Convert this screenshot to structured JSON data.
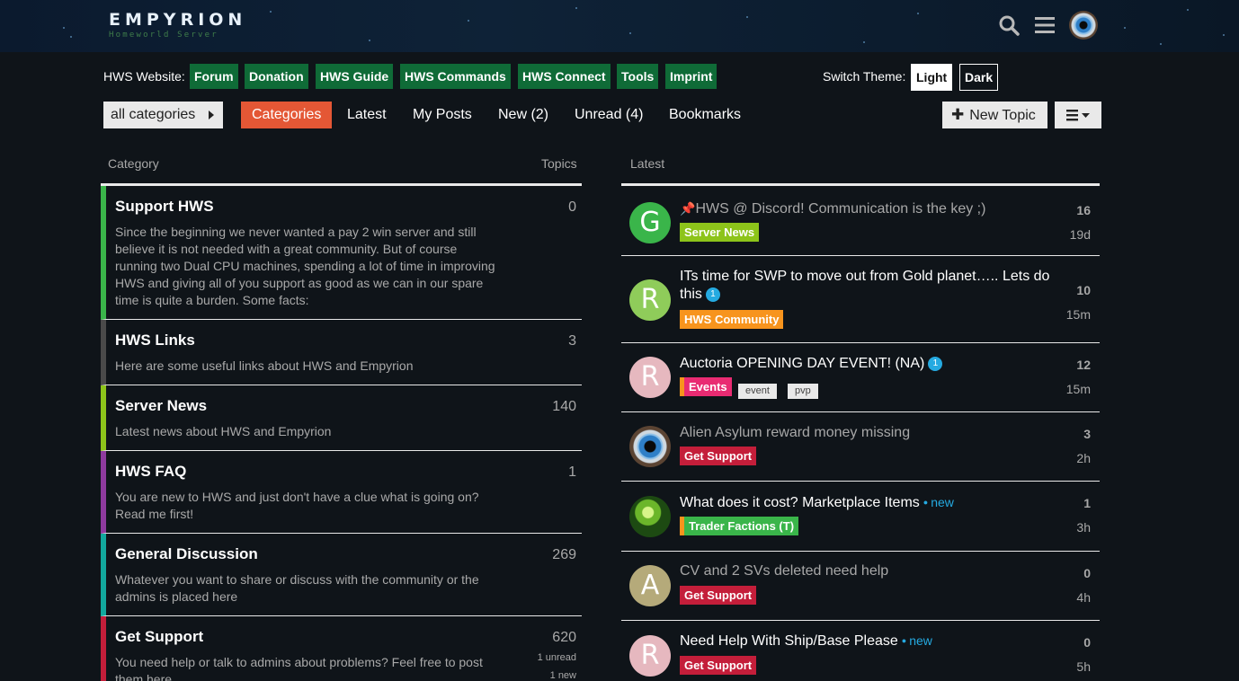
{
  "header": {
    "logo_name": "EMPYRION",
    "logo_sub": "Homeworld Server",
    "search_icon": "search-icon",
    "menu_icon": "hamburger-icon",
    "avatar_icon": "eye-avatar"
  },
  "links": {
    "label": "HWS Website:",
    "items": [
      "Forum",
      "Donation",
      "HWS Guide",
      "HWS Commands",
      "HWS Connect",
      "Tools",
      "Imprint"
    ],
    "accent": "#0f6b37"
  },
  "theme": {
    "label": "Switch Theme:",
    "light": "Light",
    "dark": "Dark"
  },
  "nav": {
    "category_dropdown": "all categories",
    "items": [
      "Categories",
      "Latest",
      "My Posts",
      "New (2)",
      "Unread (4)",
      "Bookmarks"
    ],
    "active_color": "#e45735",
    "new_topic": "New Topic"
  },
  "columns": {
    "category": "Category",
    "topics": "Topics",
    "latest": "Latest"
  },
  "categories": [
    {
      "title": "Support HWS",
      "count": "0",
      "color": "#3ab54a",
      "desc": "Since the beginning we never wanted a pay 2 win server and still believe it is not needed with a great community. But of course running two Dual CPU machines, spending a lot of time in improving HWS and giving all of you support as good as we can in our spare time is quite a burden. Some facts:"
    },
    {
      "title": "HWS Links",
      "count": "3",
      "color": "#4a4a4a",
      "desc": "Here are some useful links about HWS and Empyrion"
    },
    {
      "title": "Server News",
      "count": "140",
      "color": "#8dc41a",
      "desc": "Latest news about HWS and Empyrion"
    },
    {
      "title": "HWS FAQ",
      "count": "1",
      "color": "#8e3a9e",
      "desc": "You are new to HWS and just don't have a clue what is going on? Read me first!"
    },
    {
      "title": "General Discussion",
      "count": "269",
      "color": "#12a89d",
      "desc": "Whatever you want to share or discuss with the community or the admins is placed here"
    },
    {
      "title": "Get Support",
      "count": "620",
      "color": "#c41e3a",
      "desc": "You need help or talk to admins about problems? Feel free to post them here",
      "unread": "1 unread",
      "new": "1 new"
    }
  ],
  "topics": [
    {
      "title": "HWS @ Discord! Communication is the key ;)",
      "pinned": true,
      "read": true,
      "category": "Server News",
      "cat_color": "#8dc41a",
      "posts": "16",
      "age": "19d",
      "avatar_letter": "G",
      "avatar_color": "#3ab54a"
    },
    {
      "title": "ITs time for SWP to move out from Gold planet….. Lets do this",
      "badge": "1",
      "category": "HWS Community",
      "cat_color": "#f7941d",
      "posts": "10",
      "age": "15m",
      "avatar_letter": "R",
      "avatar_color": "#8fcc5a"
    },
    {
      "title": "Auctoria OPENING DAY EVENT! (NA)",
      "badge": "1",
      "category": "Events",
      "cat_color": "#e92b72",
      "cat_stripe": "#f7941d",
      "tags": [
        "event",
        "pvp"
      ],
      "posts": "12",
      "age": "15m",
      "avatar_letter": "R",
      "avatar_color": "#e6b8bf"
    },
    {
      "title": "Alien Asylum reward money missing",
      "read": true,
      "category": "Get Support",
      "cat_color": "#c41e3a",
      "posts": "3",
      "age": "2h",
      "avatar_icon": "eye-avatar"
    },
    {
      "title": "What does it cost? Marketplace Items",
      "new_label": "new",
      "category": "Trader Factions (T)",
      "cat_color": "#3ab54a",
      "cat_stripe": "#f7941d",
      "posts": "1",
      "age": "3h",
      "avatar_icon": "planet-avatar"
    },
    {
      "title": "CV and 2 SVs deleted need help",
      "read": true,
      "category": "Get Support",
      "cat_color": "#c41e3a",
      "posts": "0",
      "age": "4h",
      "avatar_letter": "A",
      "avatar_color": "#b5aa7a"
    },
    {
      "title": "Need Help With Ship/Base Please",
      "new_label": "new",
      "category": "Get Support",
      "cat_color": "#c41e3a",
      "posts": "0",
      "age": "5h",
      "avatar_letter": "R",
      "avatar_color": "#e6b8bf"
    }
  ]
}
